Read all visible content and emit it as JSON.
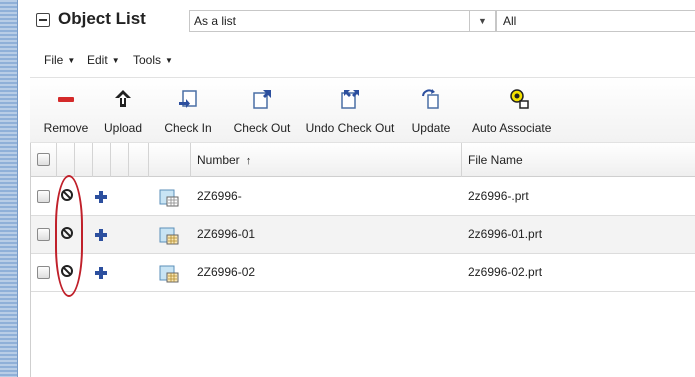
{
  "header": {
    "title": "Object List",
    "view_select_value": "As a list",
    "filter_select_value": "All"
  },
  "menu": [
    {
      "label": "File"
    },
    {
      "label": "Edit"
    },
    {
      "label": "Tools"
    }
  ],
  "toolbar": {
    "remove": "Remove",
    "upload": "Upload",
    "check_in": "Check In",
    "check_out": "Check Out",
    "undo_check_out": "Undo Check Out",
    "update": "Update",
    "auto_associate": "Auto Associate"
  },
  "grid": {
    "columns": {
      "number": "Number",
      "file_name": "File Name"
    },
    "sort_indicator": "↑",
    "rows": [
      {
        "number": "2Z6996-",
        "file_name": "2z6996-.prt"
      },
      {
        "number": "2Z6996-01",
        "file_name": "2z6996-01.prt"
      },
      {
        "number": "2Z6996-02",
        "file_name": "2z6996-02.prt"
      }
    ]
  },
  "colors": {
    "annotation": "#c0202a",
    "add_icon": "#2c4f9e",
    "remove_icon": "#d42a2a"
  }
}
